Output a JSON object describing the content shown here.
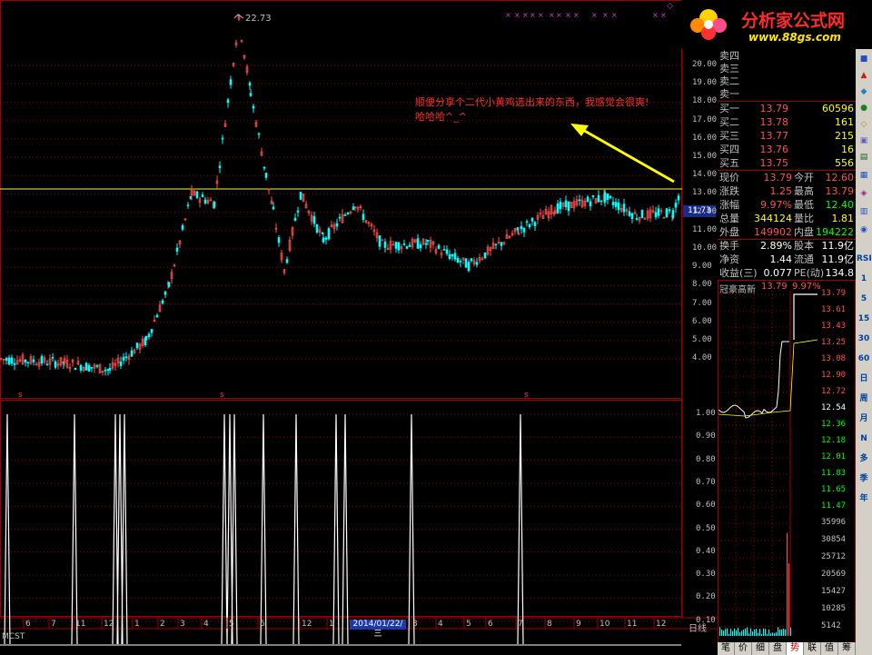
{
  "main": {
    "peak_label": "22.73",
    "current_price_marker": "11.73",
    "annotation": "顺便分享个二代小黄鸡选出来的东西，我感觉会很爽!\n哈哈哈^_^",
    "signal_marker": "s",
    "y_axis_labels": [
      "20.00",
      "19.00",
      "18.00",
      "17.00",
      "16.00",
      "15.00",
      "14.00",
      "13.00",
      "12.00",
      "11.00",
      "10.00",
      "9.00",
      "8.00",
      "7.00",
      "6.00",
      "5.00",
      "4.00"
    ],
    "y_axis_values": [
      20,
      19,
      18,
      17,
      16,
      15,
      14,
      13,
      12,
      11,
      10,
      9,
      8,
      7,
      6,
      5,
      4
    ],
    "period_label": "日线",
    "indicator_name": "MCST",
    "x_axis_labels": [
      "6",
      "7",
      "11",
      "12",
      "1",
      "2",
      "3",
      "4",
      "5",
      "6",
      "12",
      "1",
      "2",
      "3",
      "4",
      "5",
      "6",
      "7",
      "8",
      "9",
      "10",
      "11",
      "12",
      "1"
    ],
    "date_highlight": "2014/01/22/三"
  },
  "indicator": {
    "y_axis_labels": [
      "1.00",
      "0.90",
      "0.80",
      "0.70",
      "0.60",
      "0.50",
      "0.40",
      "0.30",
      "0.20",
      "0.10"
    ],
    "y_axis_values": [
      1.0,
      0.9,
      0.8,
      0.7,
      0.6,
      0.5,
      0.4,
      0.3,
      0.2,
      0.1
    ]
  },
  "logo": {
    "brand": "分析家公式网",
    "url": "www.88gs.com"
  },
  "order_book": {
    "sell": [
      {
        "label": "卖四",
        "price": "",
        "volume": ""
      },
      {
        "label": "卖三",
        "price": "",
        "volume": ""
      },
      {
        "label": "卖二",
        "price": "",
        "volume": ""
      },
      {
        "label": "卖一",
        "price": "",
        "volume": ""
      }
    ],
    "buy": [
      {
        "label": "买一",
        "price": "13.79",
        "volume": "60596"
      },
      {
        "label": "买二",
        "price": "13.78",
        "volume": "161"
      },
      {
        "label": "买三",
        "price": "13.77",
        "volume": "215"
      },
      {
        "label": "买四",
        "price": "13.76",
        "volume": "16"
      },
      {
        "label": "买五",
        "price": "13.75",
        "volume": "556"
      }
    ]
  },
  "stats": [
    {
      "a": "现价",
      "b": "13.79",
      "c": "今开",
      "d": "12.60"
    },
    {
      "a": "涨跌",
      "b": "1.25",
      "c": "最高",
      "d": "13.79"
    },
    {
      "a": "涨幅",
      "b": "9.97%",
      "c": "最低",
      "d": "12.40"
    },
    {
      "a": "总量",
      "b": "344124",
      "c": "量比",
      "d": "1.81"
    },
    {
      "a": "外盘",
      "b": "149902",
      "c": "内盘",
      "d": "194222"
    },
    {
      "a": "换手",
      "b": "2.89%",
      "c": "股本",
      "d": "11.9亿"
    },
    {
      "a": "净资",
      "b": "1.44",
      "c": "流通",
      "d": "11.9亿"
    },
    {
      "a": "收益(三)",
      "b": "0.077",
      "c": "PE(动)",
      "d": "134.8"
    }
  ],
  "intraday": {
    "title": "冠豪高新",
    "price": "13.79",
    "change": "9.97%",
    "price_labels": [
      "13.79",
      "13.61",
      "13.43",
      "13.25",
      "13.08",
      "12.90",
      "12.72",
      "12.54",
      "12.36",
      "12.18",
      "12.01",
      "11.83",
      "11.65",
      "11.47"
    ],
    "volume_labels": [
      "35996",
      "30854",
      "25712",
      "20569",
      "15427",
      "10285",
      "5142"
    ]
  },
  "toolbar": {
    "buttons": [
      "RSI",
      "1",
      "5",
      "15",
      "30",
      "60",
      "日",
      "周",
      "月",
      "N",
      "多",
      "季",
      "年"
    ]
  },
  "bottom_tabs": [
    "笔",
    "价",
    "细",
    "盘",
    "势",
    "联",
    "值",
    "筹"
  ],
  "colors": {
    "up": "#ff5050",
    "down": "#00ffff",
    "grid": "#a00000",
    "price_line": "#ffff00",
    "annotation": "#ff3030",
    "arrow": "#ffff00"
  }
}
